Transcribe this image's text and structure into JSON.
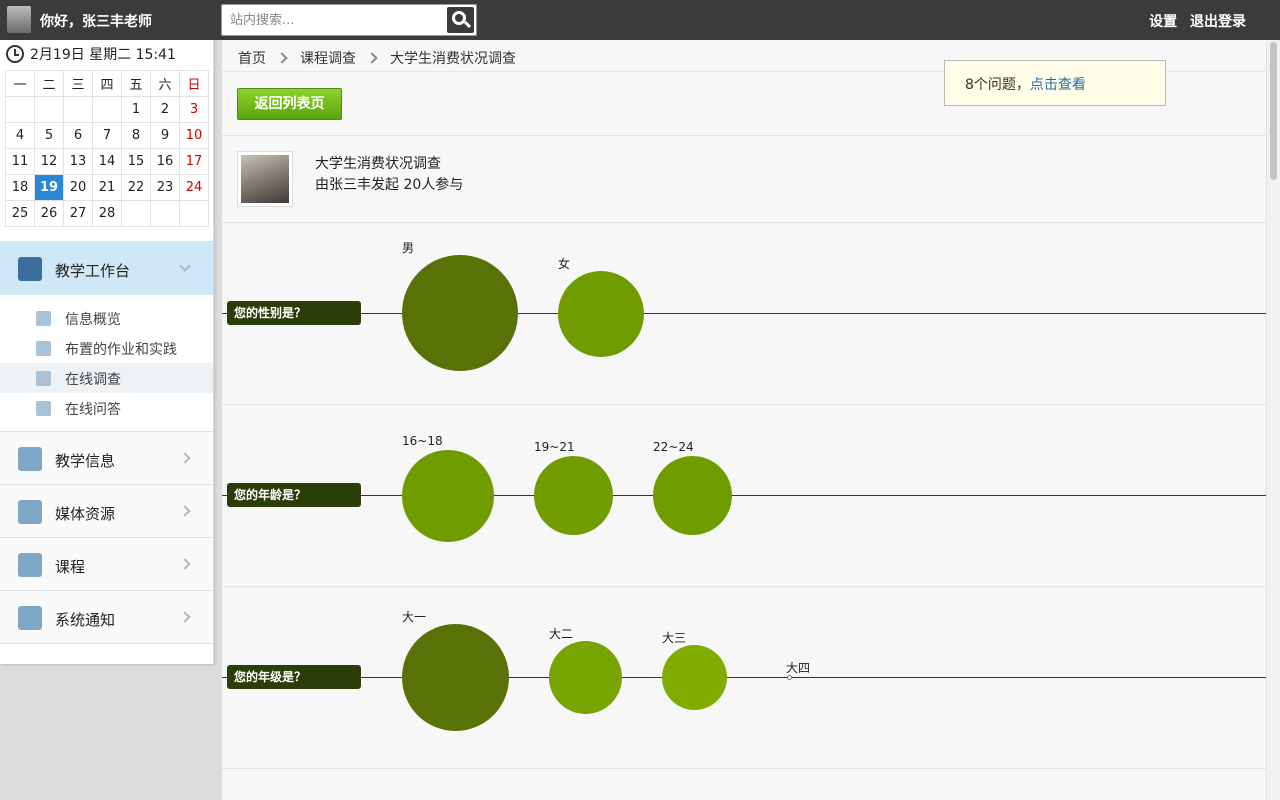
{
  "topbar": {
    "greeting": "你好，张三丰老师",
    "search_placeholder": "站内搜索...",
    "settings_label": "设置",
    "logout_label": "退出登录"
  },
  "sidebar": {
    "datetime": "2月19日 星期二 15:41",
    "calendar": {
      "weekdays": [
        "一",
        "二",
        "三",
        "四",
        "五",
        "六",
        "日"
      ],
      "weeks": [
        [
          "",
          "",
          "",
          "",
          "1",
          "2",
          "3"
        ],
        [
          "4",
          "5",
          "6",
          "7",
          "8",
          "9",
          "10"
        ],
        [
          "11",
          "12",
          "13",
          "14",
          "15",
          "16",
          "17"
        ],
        [
          "18",
          "19",
          "20",
          "21",
          "22",
          "23",
          "24"
        ],
        [
          "25",
          "26",
          "27",
          "28",
          "",
          "",
          ""
        ]
      ],
      "today": "19"
    },
    "sections": [
      {
        "label": "教学工作台",
        "icon": "dashboard-icon",
        "expanded": true
      },
      {
        "label": "教学信息",
        "icon": "document-icon"
      },
      {
        "label": "媒体资源",
        "icon": "database-icon"
      },
      {
        "label": "课程",
        "icon": "course-icon"
      },
      {
        "label": "系统通知",
        "icon": "chat-bubble-icon"
      }
    ],
    "sub_items": [
      {
        "label": "信息概览",
        "icon": "overview-icon"
      },
      {
        "label": "布置的作业和实践",
        "icon": "notebook-icon"
      },
      {
        "label": "在线调查",
        "icon": "thumbs-up-icon",
        "active": true
      },
      {
        "label": "在线问答",
        "icon": "qa-bubble-icon"
      }
    ]
  },
  "main": {
    "breadcrumb": [
      "首页",
      "课程调查",
      "大学生消费状况调查"
    ],
    "back_button": "返回列表页",
    "notice": {
      "text": "8个问题，",
      "link": "点击查看"
    },
    "survey": {
      "title": "大学生消费状况调查",
      "meta": "由张三丰发起  20人参与"
    }
  },
  "colors": {
    "topbar": "#3b3b3b",
    "label_bg": "#2b3d08",
    "bubble_dark": "#587208",
    "bubble_mid": "#709c00",
    "bubble_light": "#80ac00",
    "active_blue": "#2c86d6",
    "link": "#1f6fb5"
  },
  "chart_data": {
    "type": "bubble",
    "questions": [
      {
        "question": "您的性别是？",
        "options": [
          {
            "label": "男"
          },
          {
            "label": "女"
          }
        ]
      },
      {
        "question": "您的年龄是？",
        "options": [
          {
            "label": "16~18"
          },
          {
            "label": "19~21"
          },
          {
            "label": "22~24"
          }
        ]
      },
      {
        "question": "您的年级是？",
        "options": [
          {
            "label": "大一"
          },
          {
            "label": "大二"
          },
          {
            "label": "大三"
          },
          {
            "label": "大四"
          }
        ]
      }
    ]
  }
}
